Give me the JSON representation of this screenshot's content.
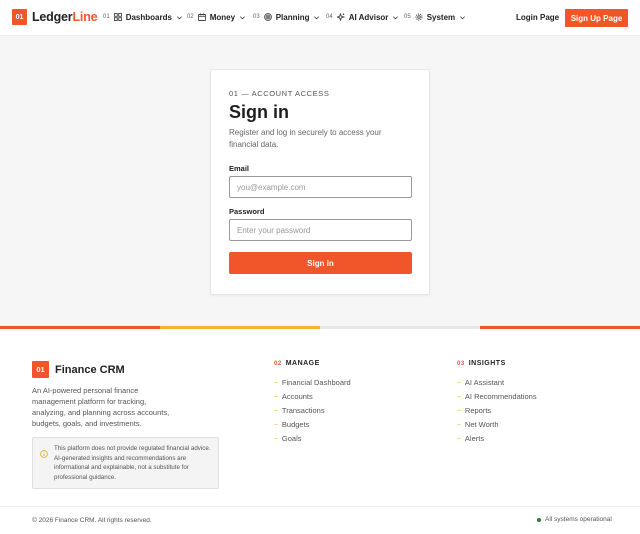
{
  "header": {
    "logo_badge": "01",
    "logo_main": "Ledger",
    "logo_accent": "Line",
    "nav": [
      {
        "num": "01",
        "label": "Dashboards"
      },
      {
        "num": "02",
        "label": "Money"
      },
      {
        "num": "03",
        "label": "Planning"
      },
      {
        "num": "04",
        "label": "AI Advisor"
      },
      {
        "num": "05",
        "label": "System"
      }
    ],
    "login_label": "Login Page",
    "signup_label": "Sign Up Page"
  },
  "card": {
    "eyebrow": "01 — ACCOUNT ACCESS",
    "title": "Sign in",
    "subtitle": "Register and log in securely to access your financial data.",
    "email_label": "Email",
    "email_placeholder": "you@example.com",
    "email_value": "",
    "password_label": "Password",
    "password_placeholder": "Enter your password",
    "password_value": "",
    "submit_label": "Sign in"
  },
  "footer": {
    "logo_badge": "01",
    "brand": "Finance CRM",
    "description": "An AI-powered personal finance management platform for tracking, analyzing, and planning across accounts, budgets, goals, and investments.",
    "notice": "This platform does not provide regulated financial advice. AI-generated insights and recommendations are informational and explainable, not a substitute for professional guidance.",
    "columns": [
      {
        "num": "02",
        "title": "MANAGE",
        "items": [
          "Financial Dashboard",
          "Accounts",
          "Transactions",
          "Budgets",
          "Goals"
        ]
      },
      {
        "num": "03",
        "title": "INSIGHTS",
        "items": [
          "AI Assistant",
          "AI Recommendations",
          "Reports",
          "Net Worth",
          "Alerts"
        ]
      }
    ],
    "copyright": "© 2026 Finance CRM. All rights reserved.",
    "status": "All systems operational"
  },
  "colors": {
    "accent": "#f0562a",
    "stripe": [
      "#f0562a",
      "#f2b42a",
      "#e6e6e6",
      "#f0562a"
    ],
    "status_dot": "#2f7a3a",
    "notice_icon": "#e0b13a"
  }
}
